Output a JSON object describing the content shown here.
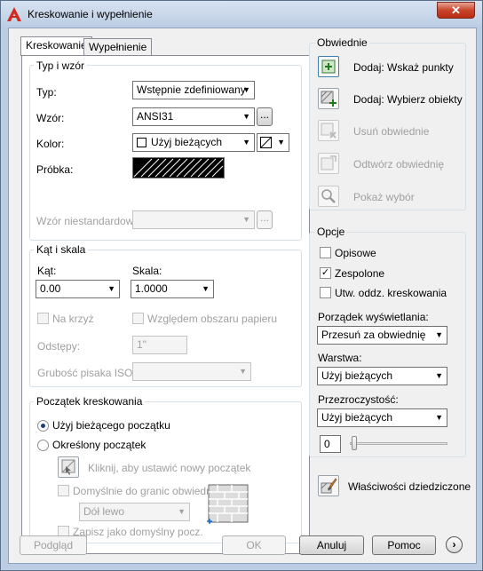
{
  "window": {
    "title": "Kreskowanie i wypełnienie",
    "close_label": "✕"
  },
  "tabs": [
    {
      "label": "Kreskowanie"
    },
    {
      "label": "Wypełnienie"
    }
  ],
  "type_pattern": {
    "group_label": "Typ i wzór",
    "type_label": "Typ:",
    "type_value": "Wstępnie zdefiniowany",
    "pattern_label": "Wzór:",
    "pattern_value": "ANSI31",
    "pattern_browse": "...",
    "color_label": "Kolor:",
    "color_value": "Użyj bieżących",
    "sample_label": "Próbka:",
    "custom_label": "Wzór niestandardowy:",
    "custom_browse": "..."
  },
  "angle_scale": {
    "group_label": "Kąt i skala",
    "angle_label": "Kąt:",
    "angle_value": "0.00",
    "scale_label": "Skala:",
    "scale_value": "1.0000",
    "crossed_label": "Na krzyż",
    "paper_label": "Względem obszaru papieru",
    "spacing_label": "Odstępy:",
    "spacing_value": "1\"",
    "iso_label": "Grubość pisaka ISO:"
  },
  "origin": {
    "group_label": "Początek kreskowania",
    "current_label": "Użyj bieżącego początku",
    "specified_label": "Określony początek",
    "click_label": "Kliknij, aby ustawić nowy początek",
    "default_label": "Domyślnie do granic obwiedni",
    "position_value": "Dół lewo",
    "store_label": "Zapisz jako domyślny pocz."
  },
  "boundaries": {
    "group_label": "Obwiednie",
    "add_pick": "Dodaj: Wskaż punkty",
    "add_select": "Dodaj: Wybierz obiekty",
    "remove": "Usuń obwiednie",
    "recreate": "Odtwórz obwiednię",
    "view": "Pokaż wybór"
  },
  "options": {
    "group_label": "Opcje",
    "annotative": "Opisowe",
    "associative": "Zespolone",
    "separate": "Utw. oddz. kreskowania",
    "draw_order_label": "Porządek wyświetlania:",
    "draw_order_value": "Przesuń za obwiednię",
    "layer_label": "Warstwa:",
    "layer_value": "Użyj bieżących",
    "transparency_label": "Przezroczystość:",
    "transparency_value": "Użyj bieżących",
    "transparency_number": "0",
    "inherit": "Właściwości dziedziczone"
  },
  "footer": {
    "preview": "Podgląd",
    "ok": "OK",
    "cancel": "Anuluj",
    "help": "Pomoc"
  }
}
